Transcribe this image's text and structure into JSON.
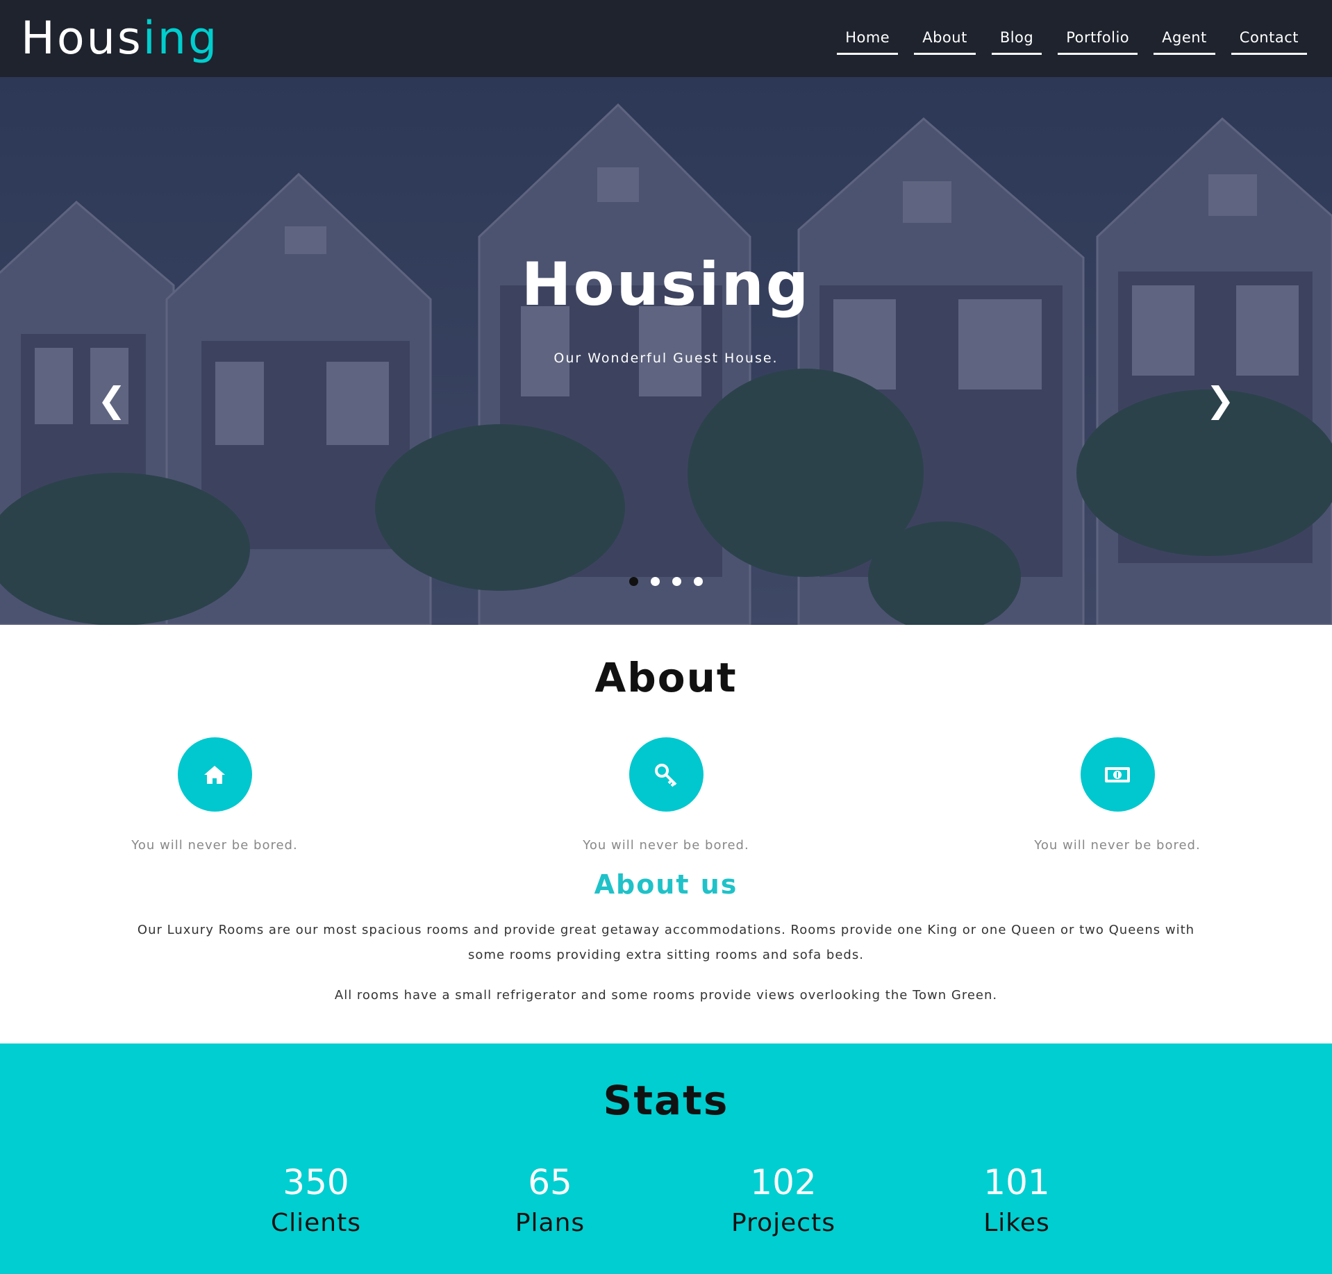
{
  "brand": {
    "logo_main": "Hous",
    "logo_accent": "ing"
  },
  "nav": {
    "items": [
      "Home",
      "About",
      "Blog",
      "Portfolio",
      "Agent",
      "Contact"
    ]
  },
  "hero": {
    "title": "Housing",
    "subtitle": "Our Wonderful Guest House.",
    "prev_icon": "chevron-left-icon",
    "next_icon": "chevron-right-icon",
    "prev_glyph": "❮",
    "next_glyph": "❯",
    "slides_count": 4,
    "active_slide": 1
  },
  "about": {
    "title": "About",
    "features": [
      {
        "icon": "home-icon",
        "text": "You will never be bored."
      },
      {
        "icon": "key-icon",
        "text": "You will never be bored."
      },
      {
        "icon": "money-icon",
        "text": "You will never be bored."
      }
    ],
    "subtitle": "About us",
    "paragraph1": "Our Luxury Rooms are our most spacious rooms and provide great getaway accommodations. Rooms provide one King or one Queen or two Queens with some rooms providing extra sitting rooms and sofa beds.",
    "paragraph2": "All rooms have a small refrigerator and some rooms provide views overlooking the Town Green."
  },
  "stats": {
    "title": "Stats",
    "items": [
      {
        "value": "350",
        "label": "Clients"
      },
      {
        "value": "65",
        "label": "Plans"
      },
      {
        "value": "102",
        "label": "Projects"
      },
      {
        "value": "101",
        "label": "Likes"
      }
    ]
  },
  "colors": {
    "accent": "#00ced0",
    "nav_bg": "#1e232d",
    "hero_overlay": "#3c4763"
  }
}
